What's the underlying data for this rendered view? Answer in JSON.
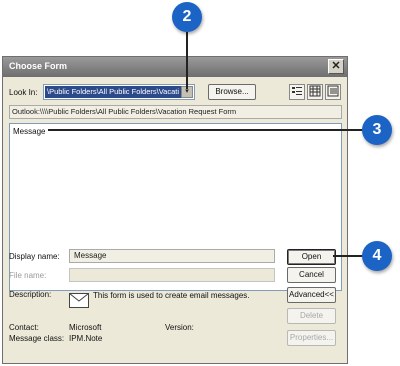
{
  "callouts": {
    "c1": "2",
    "c2": "3",
    "c3": "4"
  },
  "dialog": {
    "title": "Choose Form",
    "close_glyph": "✕",
    "look_in_label": "Look In:",
    "look_in_value": "\\Public Folders\\All Public Folders\\Vacati",
    "dropdown_glyph": "▾",
    "browse_label": "Browse...",
    "view_icons": [
      "large-icons-view-icon",
      "small-icons-view-icon",
      "details-view-icon"
    ],
    "path": "Outlook:\\\\\\\\Public Folders\\All Public Folders\\Vacation Request Form",
    "list_items": [
      "Message"
    ],
    "display_name_label": "Display name:",
    "display_name_value": "Message",
    "file_name_label": "File name:",
    "file_name_value": "",
    "description_label": "Description:",
    "description_value": "This form is used to create email messages.",
    "contact_label": "Contact:",
    "contact_value": "Microsoft",
    "version_label": "Version:",
    "version_value": "",
    "message_class_label": "Message class:",
    "message_class_value": "IPM.Note",
    "buttons": {
      "open": "Open",
      "cancel": "Cancel",
      "advanced": "Advanced<<",
      "delete": "Delete",
      "properties": "Properties..."
    }
  },
  "colors": {
    "callout": "#1b63c4",
    "titlebar": "#7a7a7a",
    "dialog_bg": "#ece9d8",
    "selection": "#2c4a8a"
  }
}
